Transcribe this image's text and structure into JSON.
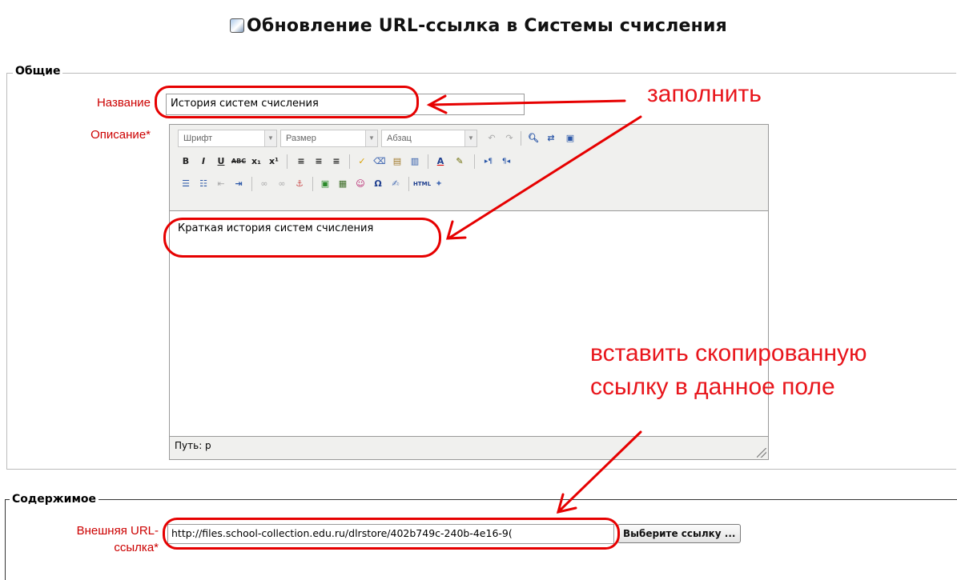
{
  "page": {
    "title": "Обновление URL-ссылка в Системы счисления",
    "title_icon": "page-icon"
  },
  "general_section": {
    "legend": "Общие",
    "name_label": "Название",
    "name_value": "История систем счисления",
    "description_label": "Описание*"
  },
  "editor": {
    "toolbar_row1": {
      "font_select": "Шрифт",
      "size_select": "Размер",
      "format_select": "Абзац",
      "buttons": [
        "undo-icon",
        "redo-icon",
        "find-icon",
        "replace-icon",
        "fullscreen-icon"
      ]
    },
    "toolbar_row2": {
      "buttons": [
        {
          "name": "bold-icon",
          "glyph": "B"
        },
        {
          "name": "italic-icon",
          "glyph": "I"
        },
        {
          "name": "underline-icon",
          "glyph": "U"
        },
        {
          "name": "strikethrough-icon",
          "glyph": "ABC"
        },
        {
          "name": "subscript-icon",
          "glyph": "x₁"
        },
        {
          "name": "superscript-icon",
          "glyph": "x¹"
        },
        {
          "name": "align-left-icon",
          "glyph": "≡"
        },
        {
          "name": "align-center-icon",
          "glyph": "≡"
        },
        {
          "name": "align-right-icon",
          "glyph": "≡"
        },
        {
          "name": "cleanup-icon",
          "glyph": "✓"
        },
        {
          "name": "eraser-icon",
          "glyph": "⌫"
        },
        {
          "name": "paste-text-icon",
          "glyph": "▤"
        },
        {
          "name": "paste-word-icon",
          "glyph": "▥"
        },
        {
          "name": "text-color-icon",
          "glyph": "A"
        },
        {
          "name": "highlight-color-icon",
          "glyph": "✎"
        },
        {
          "name": "ltr-icon",
          "glyph": "▸¶"
        },
        {
          "name": "rtl-icon",
          "glyph": "¶◂"
        }
      ]
    },
    "toolbar_row3": {
      "buttons": [
        {
          "name": "bullet-list-icon",
          "glyph": "☰"
        },
        {
          "name": "numbered-list-icon",
          "glyph": "☷"
        },
        {
          "name": "outdent-icon",
          "glyph": "⇤"
        },
        {
          "name": "indent-icon",
          "glyph": "⇥"
        },
        {
          "name": "link-icon",
          "glyph": "∞"
        },
        {
          "name": "unlink-icon",
          "glyph": "∞"
        },
        {
          "name": "anchor-icon",
          "glyph": "⚓"
        },
        {
          "name": "image-icon",
          "glyph": "▣"
        },
        {
          "name": "media-icon",
          "glyph": "▦"
        },
        {
          "name": "emoticon-icon",
          "glyph": "☺"
        },
        {
          "name": "omega-icon",
          "glyph": "Ω"
        },
        {
          "name": "spellcheck-icon",
          "glyph": "✍"
        },
        {
          "name": "html-icon",
          "glyph": "HTML"
        },
        {
          "name": "translate-icon",
          "glyph": "✦"
        }
      ]
    },
    "content": "Краткая история систем счисления",
    "path_label": "Путь: p"
  },
  "content_section": {
    "legend": "Содержимое",
    "url_label_line1": "Внешняя URL-",
    "url_label_line2": "ссылка*",
    "url_value": "http://files.school-collection.edu.ru/dlrstore/402b749c-240b-4e16-9(",
    "choose_link_button": "Выберите ссылку ..."
  },
  "annotations": {
    "fill_in": "заполнить",
    "paste_line1": "вставить скопированную",
    "paste_line2": "ссылку в данное поле",
    "color": "#e8161c"
  }
}
